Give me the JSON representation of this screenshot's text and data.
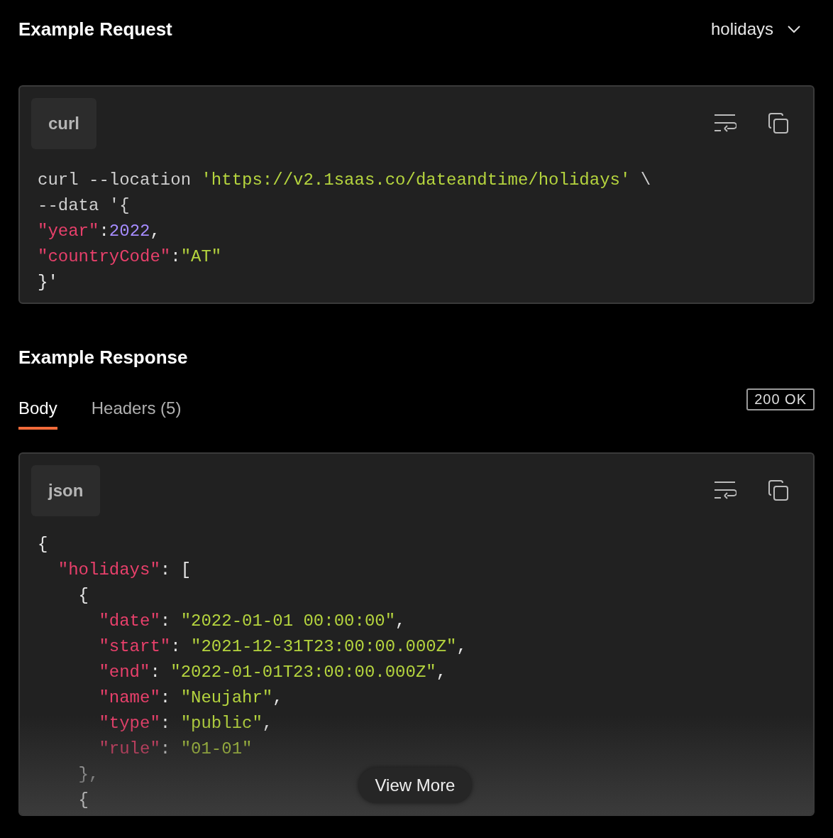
{
  "request": {
    "title": "Example Request",
    "selector": "holidays",
    "language": "curl",
    "code": [
      [
        {
          "kind": "plain",
          "text": "curl --location "
        },
        {
          "kind": "string",
          "text": "'https://v2.1saas.co/dateandtime/holidays'"
        },
        {
          "kind": "plain",
          "text": " \\"
        }
      ],
      [
        {
          "kind": "plain",
          "text": "--data '{"
        }
      ],
      [
        {
          "kind": "key",
          "text": "\"year\""
        },
        {
          "kind": "punct",
          "text": ":"
        },
        {
          "kind": "number",
          "text": "2022"
        },
        {
          "kind": "punct",
          "text": ","
        }
      ],
      [
        {
          "kind": "key",
          "text": "\"countryCode\""
        },
        {
          "kind": "punct",
          "text": ":"
        },
        {
          "kind": "string",
          "text": "\"AT\""
        }
      ],
      [
        {
          "kind": "punct",
          "text": "}'"
        }
      ]
    ]
  },
  "response": {
    "title": "Example Response",
    "tabs": [
      {
        "label": "Body",
        "selected": true
      },
      {
        "label": "Headers (5)",
        "selected": false
      }
    ],
    "status": "200 OK",
    "language": "json",
    "code": [
      [
        {
          "kind": "punct",
          "text": "{"
        }
      ],
      [
        {
          "kind": "key",
          "text": "  \"holidays\""
        },
        {
          "kind": "punct",
          "text": ": ["
        }
      ],
      [
        {
          "kind": "punct",
          "text": "    {"
        }
      ],
      [
        {
          "kind": "key",
          "text": "      \"date\""
        },
        {
          "kind": "punct",
          "text": ": "
        },
        {
          "kind": "string",
          "text": "\"2022-01-01 00:00:00\""
        },
        {
          "kind": "punct",
          "text": ","
        }
      ],
      [
        {
          "kind": "key",
          "text": "      \"start\""
        },
        {
          "kind": "punct",
          "text": ": "
        },
        {
          "kind": "string",
          "text": "\"2021-12-31T23:00:00.000Z\""
        },
        {
          "kind": "punct",
          "text": ","
        }
      ],
      [
        {
          "kind": "key",
          "text": "      \"end\""
        },
        {
          "kind": "punct",
          "text": ": "
        },
        {
          "kind": "string",
          "text": "\"2022-01-01T23:00:00.000Z\""
        },
        {
          "kind": "punct",
          "text": ","
        }
      ],
      [
        {
          "kind": "key",
          "text": "      \"name\""
        },
        {
          "kind": "punct",
          "text": ": "
        },
        {
          "kind": "string",
          "text": "\"Neujahr\""
        },
        {
          "kind": "punct",
          "text": ","
        }
      ],
      [
        {
          "kind": "key",
          "text": "      \"type\""
        },
        {
          "kind": "punct",
          "text": ": "
        },
        {
          "kind": "string",
          "text": "\"public\""
        },
        {
          "kind": "punct",
          "text": ","
        }
      ],
      [
        {
          "kind": "key",
          "text": "      \"rule\""
        },
        {
          "kind": "punct",
          "text": ": "
        },
        {
          "kind": "string",
          "text": "\"01-01\""
        }
      ],
      [
        {
          "kind": "punct",
          "text": "    },"
        }
      ],
      [
        {
          "kind": "punct",
          "text": "    {"
        }
      ]
    ],
    "more_button": "View More"
  }
}
